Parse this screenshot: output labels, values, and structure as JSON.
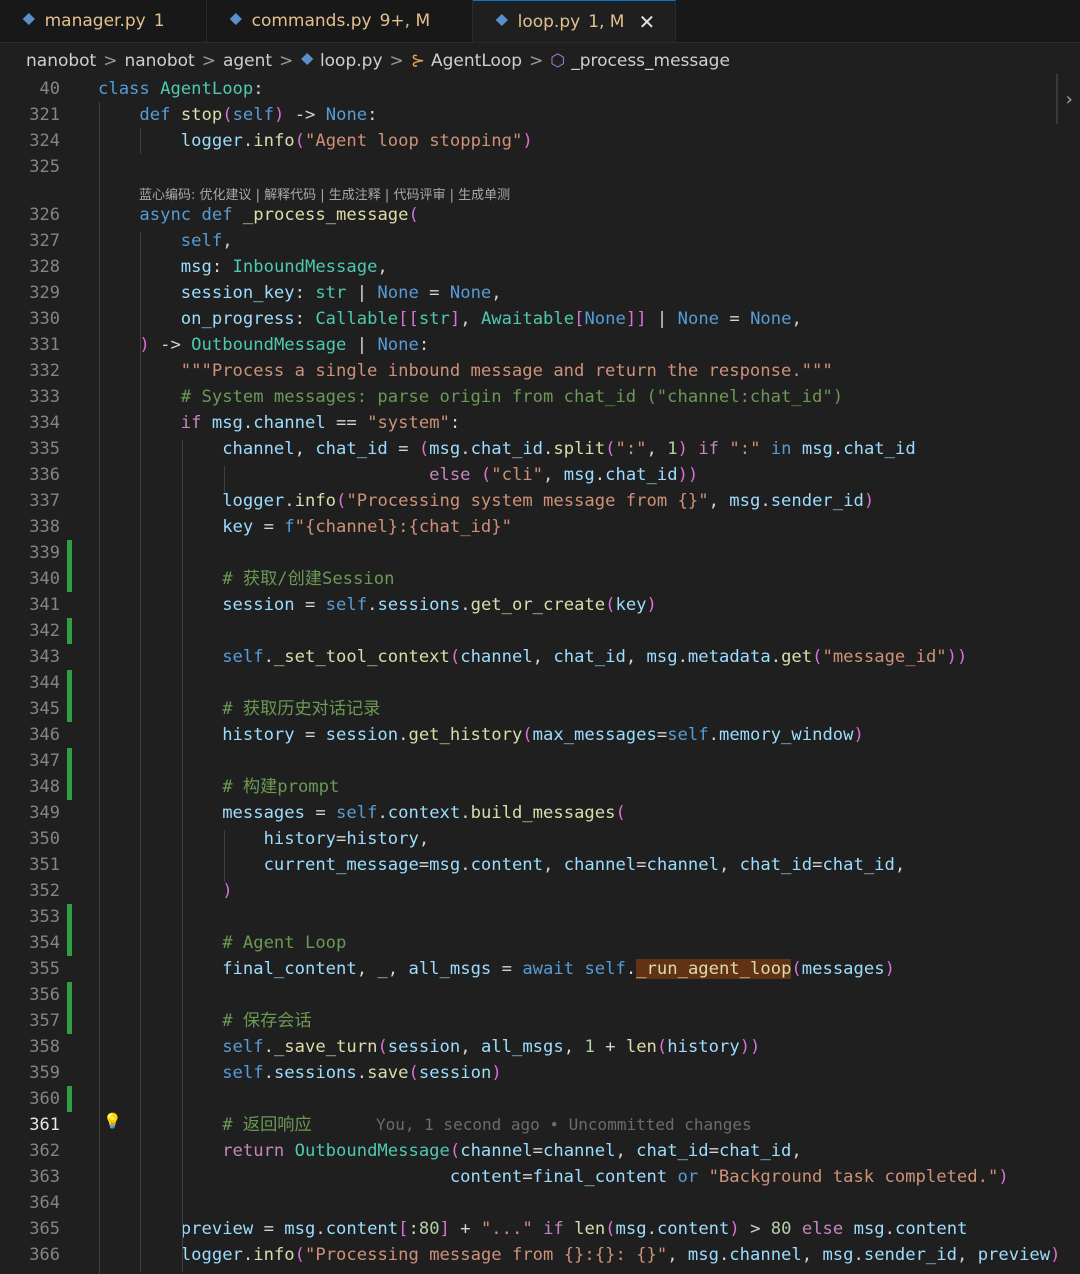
{
  "tabs": [
    {
      "name": "manager.py",
      "status": "1",
      "status_color": "#e2c08d",
      "active": false,
      "closable": false
    },
    {
      "name": "commands.py",
      "status": "9+, M",
      "status_color": "#e2c08d",
      "active": false,
      "closable": false
    },
    {
      "name": "loop.py",
      "status": "1, M",
      "status_color": "#e2c08d",
      "active": true,
      "closable": true
    }
  ],
  "breadcrumb": {
    "items": [
      "nanobot",
      "nanobot",
      "agent",
      "loop.py",
      "AgentLoop",
      "_process_message"
    ],
    "separator": ">"
  },
  "codelens": "蓝心编码: 优化建议 | 解释代码 | 生成注释 | 代码评审 | 生成单测",
  "blame": "You, 1 second ago • Uncommitted changes",
  "lines": [
    {
      "n": "40",
      "t": "class AgentLoop:"
    },
    {
      "n": "321",
      "t": "    def stop(self) -> None:"
    },
    {
      "n": "324",
      "t": "        logger.info(\"Agent loop stopping\")"
    },
    {
      "n": "325",
      "t": ""
    },
    {
      "n": "326",
      "t": "    async def _process_message("
    },
    {
      "n": "327",
      "t": "        self,"
    },
    {
      "n": "328",
      "t": "        msg: InboundMessage,"
    },
    {
      "n": "329",
      "t": "        session_key: str | None = None,"
    },
    {
      "n": "330",
      "t": "        on_progress: Callable[[str], Awaitable[None]] | None = None,"
    },
    {
      "n": "331",
      "t": "    ) -> OutboundMessage | None:"
    },
    {
      "n": "332",
      "t": "        \"\"\"Process a single inbound message and return the response.\"\"\""
    },
    {
      "n": "333",
      "t": "        # System messages: parse origin from chat_id (\"channel:chat_id\")"
    },
    {
      "n": "334",
      "t": "        if msg.channel == \"system\":"
    },
    {
      "n": "335",
      "t": "            channel, chat_id = (msg.chat_id.split(\":\", 1) if \":\" in msg.chat_id"
    },
    {
      "n": "336",
      "t": "                                else (\"cli\", msg.chat_id))"
    },
    {
      "n": "337",
      "t": "            logger.info(\"Processing system message from {}\", msg.sender_id)"
    },
    {
      "n": "338",
      "t": "            key = f\"{channel}:{chat_id}\""
    },
    {
      "n": "339",
      "t": ""
    },
    {
      "n": "340",
      "t": "            # 获取/创建Session"
    },
    {
      "n": "341",
      "t": "            session = self.sessions.get_or_create(key)"
    },
    {
      "n": "342",
      "t": ""
    },
    {
      "n": "343",
      "t": "            self._set_tool_context(channel, chat_id, msg.metadata.get(\"message_id\"))"
    },
    {
      "n": "344",
      "t": ""
    },
    {
      "n": "345",
      "t": "            # 获取历史对话记录"
    },
    {
      "n": "346",
      "t": "            history = session.get_history(max_messages=self.memory_window)"
    },
    {
      "n": "347",
      "t": ""
    },
    {
      "n": "348",
      "t": "            # 构建prompt"
    },
    {
      "n": "349",
      "t": "            messages = self.context.build_messages("
    },
    {
      "n": "350",
      "t": "                history=history,"
    },
    {
      "n": "351",
      "t": "                current_message=msg.content, channel=channel, chat_id=chat_id,"
    },
    {
      "n": "352",
      "t": "            )"
    },
    {
      "n": "353",
      "t": ""
    },
    {
      "n": "354",
      "t": "            # Agent Loop"
    },
    {
      "n": "355",
      "t": "            final_content, _, all_msgs = await self._run_agent_loop(messages)"
    },
    {
      "n": "356",
      "t": ""
    },
    {
      "n": "357",
      "t": "            # 保存会话"
    },
    {
      "n": "358",
      "t": "            self._save_turn(session, all_msgs, 1 + len(history))"
    },
    {
      "n": "359",
      "t": "            self.sessions.save(session)"
    },
    {
      "n": "360",
      "t": ""
    },
    {
      "n": "361",
      "t": "            # 返回响应"
    },
    {
      "n": "362",
      "t": "            return OutboundMessage(channel=channel, chat_id=chat_id,"
    },
    {
      "n": "363",
      "t": "                                  content=final_content or \"Background task completed.\")"
    },
    {
      "n": "364",
      "t": ""
    },
    {
      "n": "365",
      "t": "        preview = msg.content[:80] + \"...\" if len(msg.content) > 80 else msg.content"
    },
    {
      "n": "366",
      "t": "        logger.info(\"Processing message from {}:{}: {}\", msg.channel, msg.sender_id, preview)"
    }
  ],
  "added_lines": [
    "339",
    "340",
    "342",
    "344",
    "345",
    "347",
    "348",
    "353",
    "354",
    "356",
    "357",
    "360"
  ],
  "current_line": "361",
  "colors": {
    "keyword": "#569cd6",
    "control": "#c586c0",
    "class": "#4ec9b0",
    "function": "#dcdcaa",
    "string": "#ce9178",
    "comment": "#6a9955",
    "variable": "#9cdcfe",
    "number": "#b5cea8",
    "added_gutter": "#2ea043",
    "tab_active_border": "#0078d4",
    "background": "#1f1f1f"
  }
}
